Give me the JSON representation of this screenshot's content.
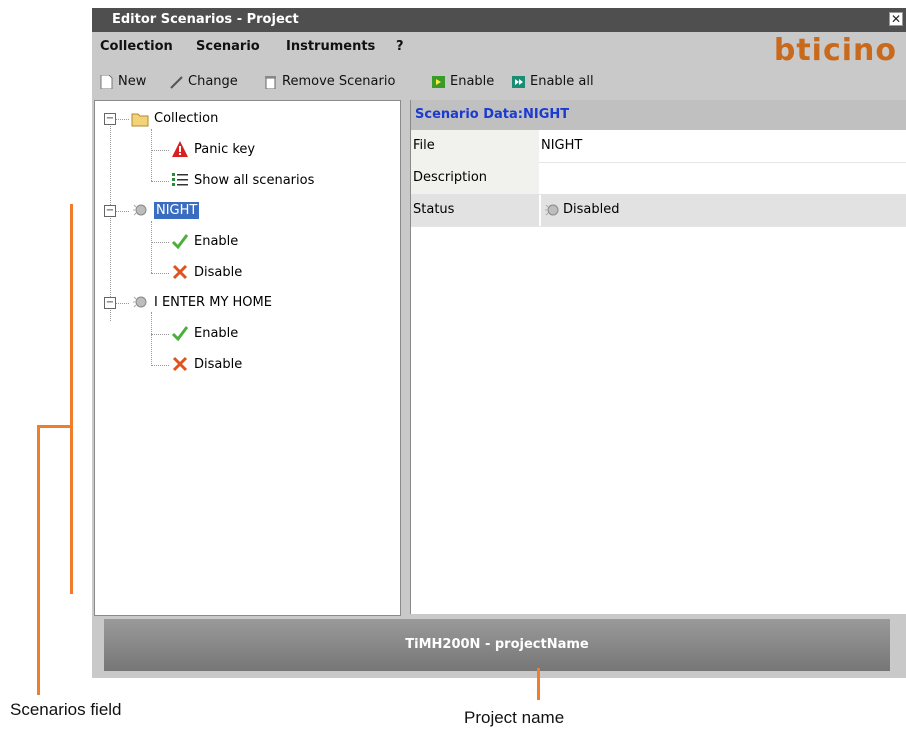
{
  "window": {
    "title": "Editor Scenarios - Project",
    "close_glyph": "✕"
  },
  "menu": {
    "items": [
      "Collection",
      "Scenario",
      "Instruments",
      "?"
    ],
    "brand": "bticino"
  },
  "toolbar": {
    "new_label": "New",
    "change_label": "Change",
    "remove_label": "Remove Scenario",
    "enable_label": "Enable",
    "enable_all_label": "Enable all"
  },
  "tree": {
    "collection_label": "Collection",
    "panic_label": "Panic key",
    "show_all_label": "Show all scenarios",
    "night_label": "NIGHT",
    "night_enable": "Enable",
    "night_disable": "Disable",
    "home_label": "I ENTER MY HOME",
    "home_enable": "Enable",
    "home_disable": "Disable"
  },
  "data": {
    "header": "Scenario Data:NIGHT",
    "file_key": "File",
    "file_value": "NIGHT",
    "description_key": "Description",
    "description_value": "",
    "status_key": "Status",
    "status_value": "Disabled"
  },
  "status": {
    "project_name": "TiMH200N - projectName"
  },
  "annotations": {
    "scenarios_field": "Scenarios field",
    "project_name": "Project name"
  },
  "colors": {
    "accent_orange": "#ef7d2b",
    "selection_blue": "#3a6dc1",
    "header_blue": "#1a3ad0"
  }
}
